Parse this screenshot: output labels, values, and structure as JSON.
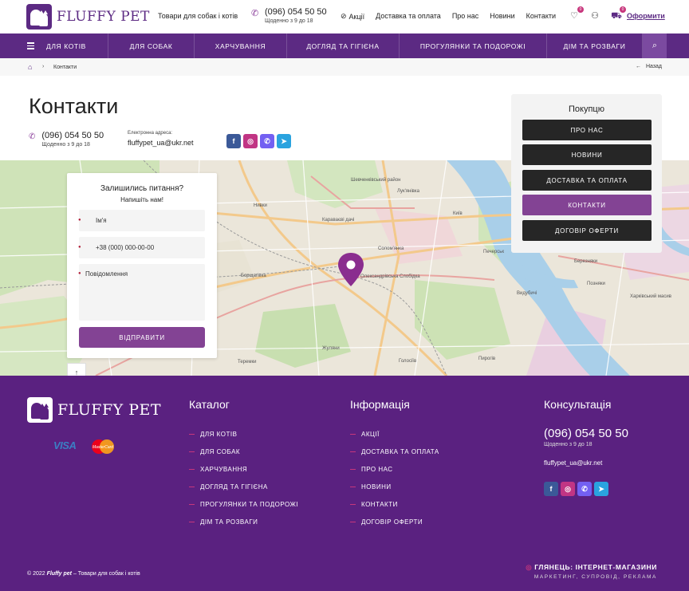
{
  "header": {
    "brand": "FLUFFY PET",
    "tagline": "Товари для собак і котів",
    "phone": "(096) 054 50 50",
    "hours": "Щоденно з 9 до 18",
    "nav": [
      "Акції",
      "Доставка та оплата",
      "Про нас",
      "Новини",
      "Контакти"
    ],
    "wishlist_count": "0",
    "cart_count": "0",
    "checkout_label": "Оформити"
  },
  "mainnav": {
    "items": [
      "ДЛЯ КОТІВ",
      "ДЛЯ СОБАК",
      "ХАРЧУВАННЯ",
      "ДОГЛЯД ТА ГІГІЄНА",
      "ПРОГУЛЯНКИ ТА ПОДОРОЖІ",
      "ДІМ ТА РОЗВАГИ"
    ]
  },
  "breadcrumb": {
    "current": "Контакти",
    "back": "Назад"
  },
  "contacts": {
    "title": "Контакти",
    "phone": "(096) 054 50 50",
    "hours": "Щоденно з 9 до 18",
    "email_label": "Електронна адреса:",
    "email": "fluffypet_ua@ukr.net"
  },
  "socials": [
    {
      "icon": "facebook-icon",
      "glyph": "f",
      "color": "#3b5998"
    },
    {
      "icon": "instagram-icon",
      "glyph": "◎",
      "color": "#c13584"
    },
    {
      "icon": "viber-icon",
      "glyph": "✆",
      "color": "#7360f2"
    },
    {
      "icon": "telegram-icon",
      "glyph": "➤",
      "color": "#2aa3df"
    }
  ],
  "form": {
    "title": "Залишились питання?",
    "subtitle": "Напишіть нам!",
    "name_placeholder": "Ім'я",
    "phone_placeholder": "+38 (000) 000-00-00",
    "message_placeholder": "Повідомлення",
    "submit": "ВІДПРАВИТИ"
  },
  "side_menu": {
    "title": "Покупцю",
    "items": [
      "ПРО НАС",
      "НОВИНИ",
      "ДОСТАВКА ТА ОПЛАТА",
      "КОНТАКТИ",
      "ДОГОВІР ОФЕРТИ"
    ],
    "active_index": 3
  },
  "map_labels": [
    "Київ",
    "Солом'янка",
    "Олександрівська Слобідка",
    "Борщагівка",
    "Жуляни",
    "Голосіїв",
    "Печерськ",
    "Видубичі",
    "Березняки",
    "Позняки",
    "Харківський масив",
    "Теремки",
    "Пирогів",
    "Караваєві дачі",
    "Нивки",
    "Лук'янівка",
    "Шевченківський район"
  ],
  "footer": {
    "brand": "FLUFFY PET",
    "payment": {
      "visa": "VISA",
      "mastercard": "MasterCard"
    },
    "catalog_title": "Каталог",
    "catalog": [
      "ДЛЯ КОТІВ",
      "ДЛЯ СОБАК",
      "ХАРЧУВАННЯ",
      "ДОГЛЯД ТА ГІГІЄНА",
      "ПРОГУЛЯНКИ ТА ПОДОРОЖІ",
      "ДІМ ТА РОЗВАГИ"
    ],
    "info_title": "Інформація",
    "info": [
      "АКЦІЇ",
      "ДОСТАВКА ТА ОПЛАТА",
      "ПРО НАС",
      "НОВИНИ",
      "КОНТАКТИ",
      "ДОГОВІР ОФЕРТИ"
    ],
    "consult_title": "Консультація",
    "phone": "(096) 054 50 50",
    "hours": "Щоденно з 9 до 18",
    "email": "fluffypet_ua@ukr.net",
    "copyright_year": "© 2022",
    "copyright_brand": "Fluffy pet",
    "copyright_rest": " – Товари для собак і котів",
    "dev_line1_mark": "◎",
    "dev_line1": "ГЛЯНЕЦЬ: ІНТЕРНЕТ-МАГАЗИНИ",
    "dev_line2": "МАРКЕТИНГ, СУПРОВІД, РЕКЛАМА"
  },
  "colors": {
    "brand": "#5c2a83",
    "accent": "#834394",
    "pink": "#c7367c"
  }
}
